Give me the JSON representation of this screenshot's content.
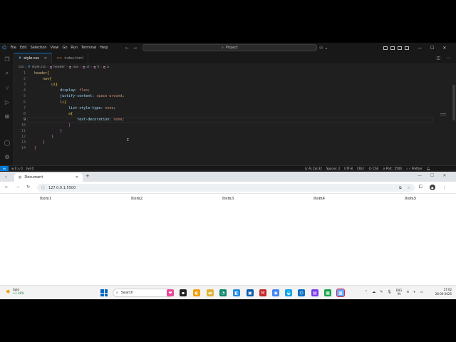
{
  "vscode": {
    "menu": [
      "File",
      "Edit",
      "Selection",
      "View",
      "Go",
      "Run",
      "Terminal",
      "Help"
    ],
    "command_center": "Project",
    "tabs": [
      {
        "label": "style.css",
        "active": true
      },
      {
        "label": "index.html",
        "active": false
      }
    ],
    "breadcrumb": [
      "css",
      "style.css",
      "header",
      "nav",
      "ul",
      "li",
      "a"
    ],
    "lines": [
      {
        "n": "1",
        "text": "header{"
      },
      {
        "n": "2",
        "text": "    nav{"
      },
      {
        "n": "3",
        "text": "        ul{"
      },
      {
        "n": "4",
        "text": "            display: flex;"
      },
      {
        "n": "5",
        "text": "            justify-content: space-around;"
      },
      {
        "n": "6",
        "text": "            li{"
      },
      {
        "n": "7",
        "text": "                list-style-type: none;"
      },
      {
        "n": "8",
        "text": "                a{"
      },
      {
        "n": "9",
        "text": "                    text-decoration: none;"
      },
      {
        "n": "10",
        "text": "                }"
      },
      {
        "n": "11",
        "text": "            }"
      },
      {
        "n": "12",
        "text": "        }"
      },
      {
        "n": "13",
        "text": "    }"
      },
      {
        "n": "14",
        "text": "}"
      }
    ],
    "status": {
      "problems": "⊗ 0 ⚠ 0",
      "remote_signal": "(w) 0",
      "position": "Ln 9, Col 32",
      "spaces": "Spaces: 2",
      "encoding": "UTF-8",
      "eol": "CRLF",
      "language": "{} CSS",
      "port": "⊘ Port : 5500",
      "prettier": "✓✓ Prettier"
    }
  },
  "chrome": {
    "tab_title": "Document",
    "url": "127.0.0.1:5500",
    "items": [
      "Item1",
      "Item2",
      "Item3",
      "Item4",
      "Item5"
    ]
  },
  "taskbar": {
    "weather_label": "Gold",
    "weather_change": "+1.18%",
    "search_placeholder": "Search",
    "lang_line1": "ENG",
    "lang_line2": "IN",
    "time": "17:02",
    "date": "28-09-2025"
  }
}
